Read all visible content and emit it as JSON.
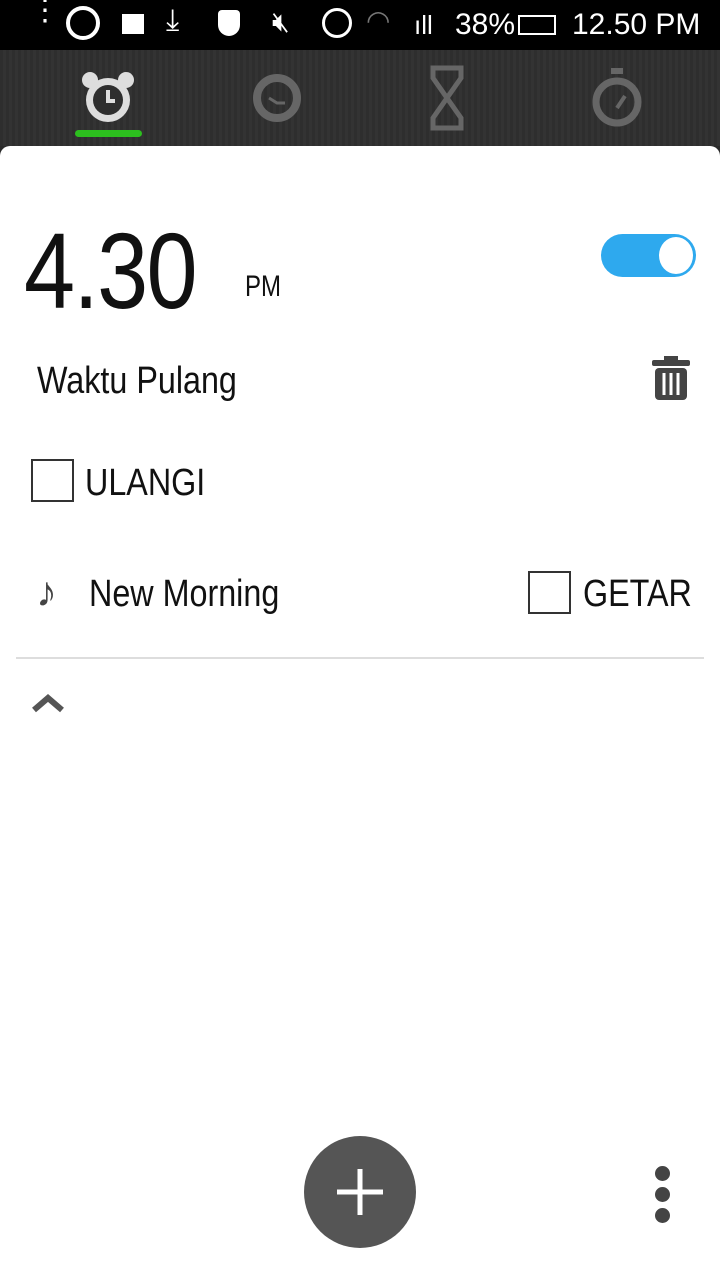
{
  "status_bar": {
    "battery": "38%",
    "time": "12.50 PM",
    "icons": [
      "overflow-dots",
      "whatsapp",
      "image",
      "download",
      "shield",
      "mute",
      "alarm",
      "wifi",
      "signal",
      "battery-charging"
    ]
  },
  "tabs": [
    {
      "name": "alarm",
      "active": true
    },
    {
      "name": "world-clock"
    },
    {
      "name": "timer"
    },
    {
      "name": "stopwatch"
    }
  ],
  "alarm": {
    "time": "4.30",
    "period": "PM",
    "enabled": true,
    "label": "Waktu Pulang",
    "repeat_label": "ULANGI",
    "repeat_checked": false,
    "ringtone": "New Morning",
    "vibrate_label": "GETAR",
    "vibrate_checked": false
  },
  "colors": {
    "accent": "#2ea9ee",
    "tab_indicator": "#2cbf1e"
  }
}
